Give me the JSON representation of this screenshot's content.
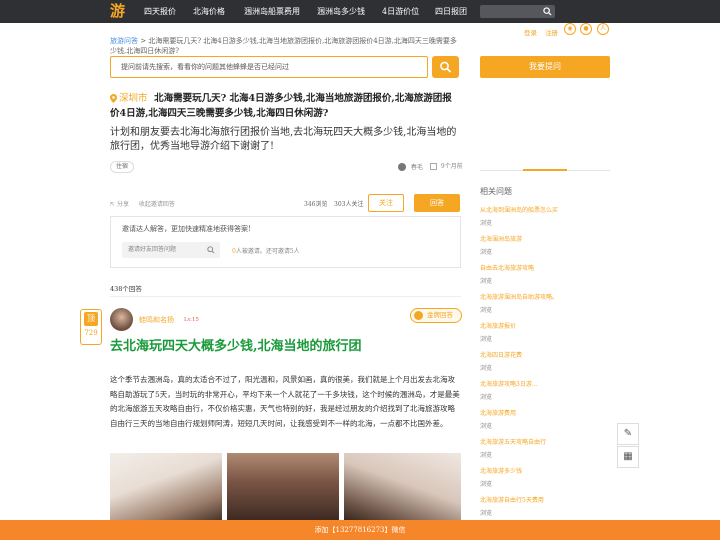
{
  "topnav": {
    "logo": "游",
    "items": [
      "四天报价",
      "北海价格",
      "涠洲岛船票费用",
      "涠洲岛多少钱",
      "4日游价位",
      "四日报团"
    ]
  },
  "breadcrumb": {
    "home": "旅游问答",
    "sep": " > ",
    "current": "北海需要玩几天? 北海4日游多少钱,北海当地旅游团报价,北海旅游团报价4日游,北海四天三晚需要多少钱,北海四日休闲游?"
  },
  "search": {
    "placeholder": "提问前请先搜索，看看你的问题其他蜂蜂是否已经问过"
  },
  "question": {
    "city": "深圳市",
    "title": "北海需要玩几天? 北海4日游多少钱,北海当地旅游团报价,北海旅游团报价4日游,北海四天三晚需要多少钱,北海四日休闲游?",
    "description": "计划和朋友要去北海北海旅行团报价当地,去北海玩四天大概多少钱,北海当地的旅行团，优秀当地导游介绍下谢谢了!",
    "tag": "住宿",
    "asker": "春毛",
    "time": "9个月前"
  },
  "actions": {
    "share": "分享",
    "collect": "收起邀请回答",
    "views": "346浏览",
    "followers": "303人关注",
    "follow_label": "关注",
    "answer_label": "回答"
  },
  "invite": {
    "heading": "邀请达人解答，更加快速精准地获得答案!",
    "input_placeholder": "邀请好友回答问题",
    "count_num": "0",
    "count_text": "人被邀请。还可邀请5人"
  },
  "answers_count": "438个回答",
  "answer": {
    "vote_label": "顶",
    "vote_count": "729",
    "author": "蛙鸣和名扬",
    "level": "Lv.15",
    "medal": "金牌回答",
    "title": "去北海玩四天大概多少钱,北海当地的旅行团",
    "body": "这个季节去涠洲岛，真的太适合不过了，阳光温和，风景如画，真的很美，我们就是上个月出发去北海攻略自助游玩了5天，当时玩的非常开心，平均下来一个人就花了一千多块钱，这个时候的涠洲岛，才是最美的北海旅游五天攻略自由行，不仅价格实惠，天气也特别的好，我是经过朋友的介绍找到了北海旅游攻略自由行三天的当地自由行规划师阿涛，短短几天时间，让我感受到不一样的北海，一点都不比国外差。"
  },
  "sidebar": {
    "login": "登录",
    "register": "注册",
    "ask_label": "我要提问",
    "related_heading": "相关问题",
    "related": [
      {
        "title": "从北海到涠洲岛的船票怎么买",
        "sub": "浏览"
      },
      {
        "title": "北海涠洲岛旅游",
        "sub": "浏览"
      },
      {
        "title": "自由去北海旅游攻略",
        "sub": "浏览"
      },
      {
        "title": "北海旅游涠洲岛自助游攻略。",
        "sub": "浏览"
      },
      {
        "title": "北海旅游报价",
        "sub": "浏览"
      },
      {
        "title": "北海四日游花费",
        "sub": "浏览"
      },
      {
        "title": "北海旅游攻略3日游…",
        "sub": "浏览"
      },
      {
        "title": "北海旅游费用",
        "sub": "浏览"
      },
      {
        "title": "北海旅游五天攻略自由行",
        "sub": "浏览"
      },
      {
        "title": "北海旅游多少钱",
        "sub": "浏览"
      },
      {
        "title": "北海旅游自由行5天费用",
        "sub": "浏览"
      }
    ]
  },
  "bottombar": "添加【13277816273】微信",
  "colors": {
    "accent": "#f5a623",
    "green_title": "#1a9a3a",
    "topbar": "#2f3033",
    "bottombar": "#f5862a"
  }
}
